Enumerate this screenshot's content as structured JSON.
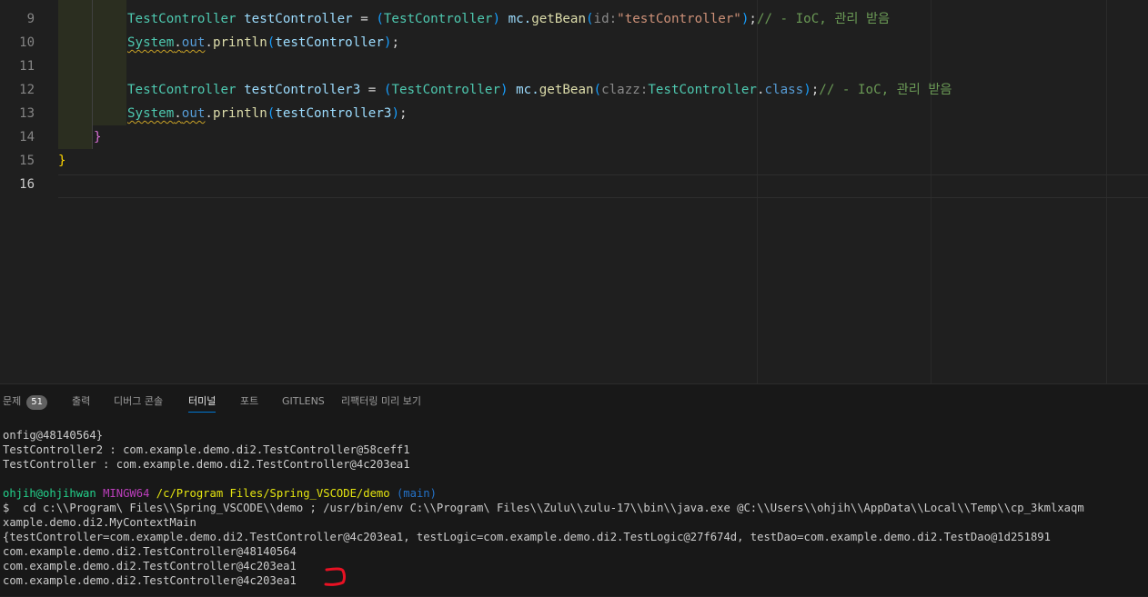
{
  "editor": {
    "line_numbers": [
      "9",
      "10",
      "11",
      "12",
      "13",
      "14",
      "15",
      "16"
    ],
    "active_line": "16",
    "lines": {
      "l9": {
        "type1": "TestController",
        "var1": " testController",
        "eq": " = ",
        "p_open": "(",
        "type2": "TestController",
        "p_close": ")",
        "call": " mc.",
        "fn": "getBean",
        "a_open": "(",
        "hint": "id:",
        "str": "\"testController\"",
        "a_close": ")",
        "semi": ";",
        "comment": "// - IoC, 관리 받음"
      },
      "l10": {
        "cls": "System",
        "dot1": ".",
        "field": "out",
        "dot2": ".",
        "fn": "println",
        "open": "(",
        "arg": "testController",
        "close": ")",
        "semi": ";"
      },
      "l12": {
        "type1": "TestController",
        "var1": " testController3",
        "eq": " = ",
        "p_open": "(",
        "type2": "TestController",
        "p_close": ")",
        "call": " mc.",
        "fn": "getBean",
        "a_open": "(",
        "hint": "clazz:",
        "cls": "TestController",
        "dot": ".",
        "kw": "class",
        "a_close": ")",
        "semi": ";",
        "comment": "// - IoC, 관리 받음"
      },
      "l13": {
        "cls": "System",
        "dot1": ".",
        "field": "out",
        "dot2": ".",
        "fn": "println",
        "open": "(",
        "arg": "testController3",
        "close": ")",
        "semi": ";"
      },
      "l14": "}",
      "l15": "}"
    }
  },
  "panel": {
    "tabs": [
      {
        "label": "문제",
        "badge": "51"
      },
      {
        "label": "출력"
      },
      {
        "label": "디버그 콘솔"
      },
      {
        "label": "터미널",
        "active": true
      },
      {
        "label": "포트"
      },
      {
        "label": "GITLENS"
      },
      {
        "label": "리팩터링 미리 보기"
      }
    ]
  },
  "terminal": {
    "line1": "onfig@48140564}",
    "line2": "TestController2 : com.example.demo.di2.TestController@58ceff1",
    "line3": "TestController : com.example.demo.di2.TestController@4c203ea1",
    "prompt": {
      "user": "ohjih@ohjihwan",
      "host": "MINGW64",
      "path": "/c/Program Files/Spring_VSCODE/demo",
      "branch": "(main)"
    },
    "command": "$  cd c:\\\\Program\\ Files\\\\Spring_VSCODE\\\\demo ; /usr/bin/env C:\\\\Program\\ Files\\\\Zulu\\\\zulu-17\\\\bin\\\\java.exe @C:\\\\Users\\\\ohjih\\\\AppData\\\\Local\\\\Temp\\\\cp_3kmlxaqm",
    "line6": "xample.demo.di2.MyContextMain",
    "line7": "{testController=com.example.demo.di2.TestController@4c203ea1, testLogic=com.example.demo.di2.TestLogic@27f674d, testDao=com.example.demo.di2.TestDao@1d251891",
    "line8": "com.example.demo.di2.TestController@48140564",
    "line9": "com.example.demo.di2.TestController@4c203ea1",
    "line10": "com.example.demo.di2.TestController@4c203ea1",
    "annotation_color": "#e81123"
  }
}
